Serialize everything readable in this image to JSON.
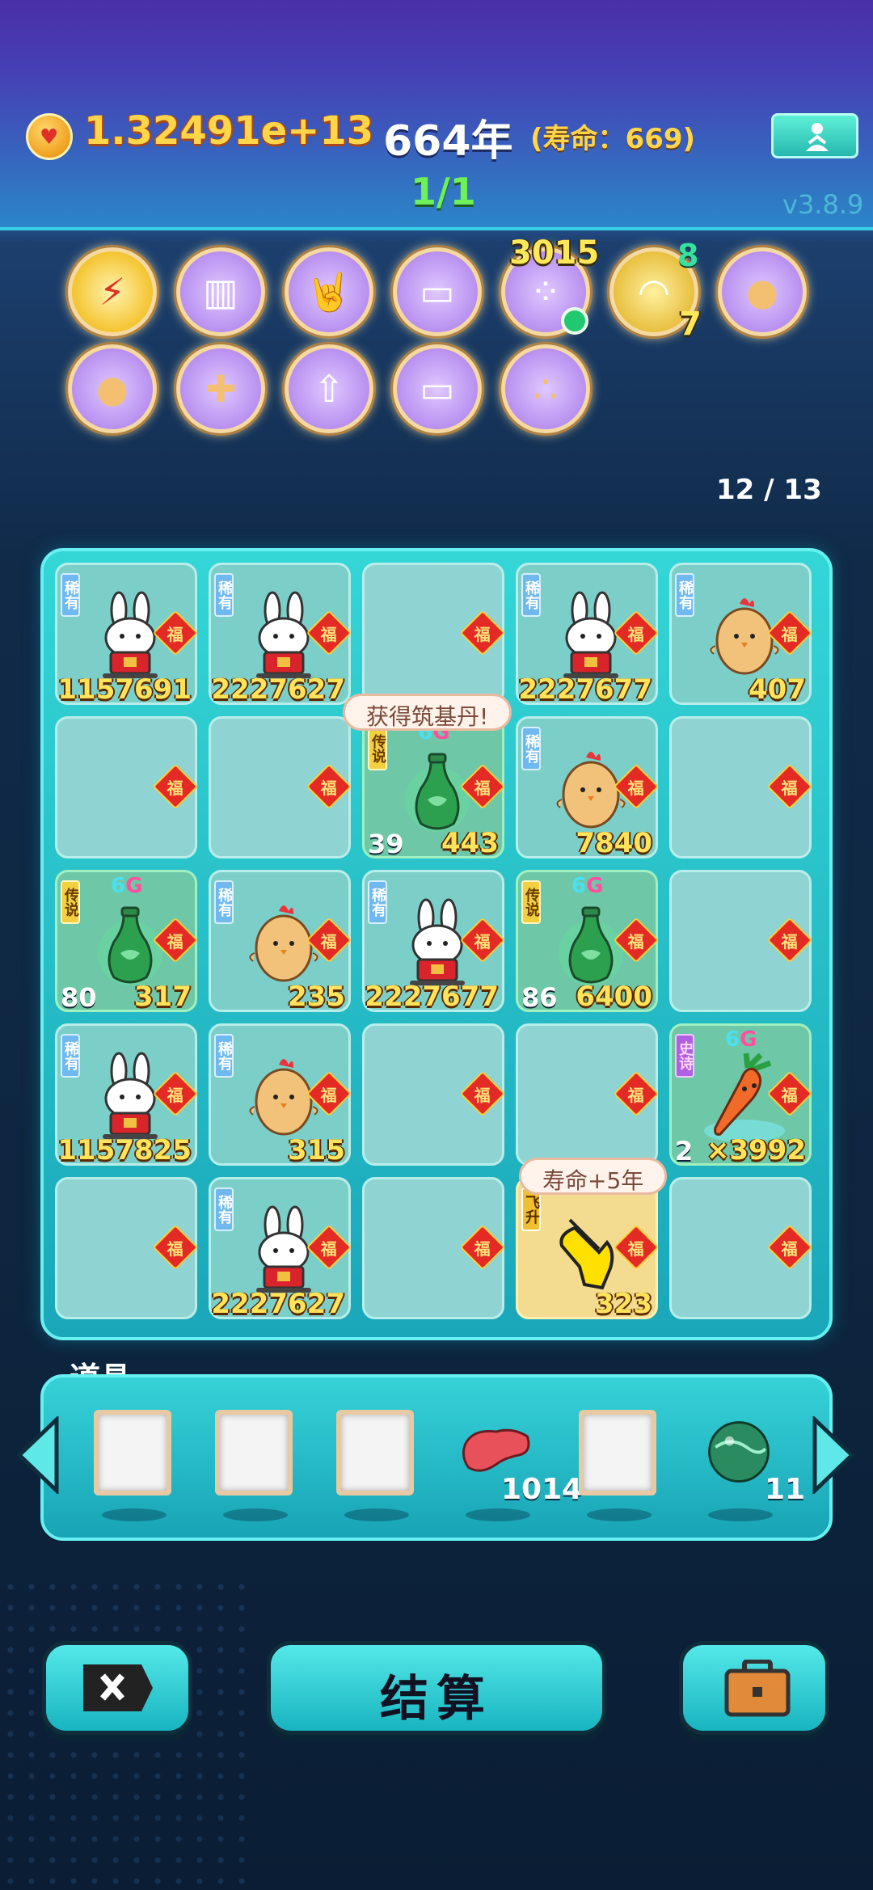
{
  "header": {
    "money": "1.32491e+13",
    "year": "664年",
    "lifespan": "(寿命：669)",
    "wave": "1/1",
    "version": "v3.8.9",
    "coin_icon": "heart-coin-icon",
    "meditate_icon": "meditation-icon"
  },
  "buffs": [
    {
      "icon": "lightning-icon",
      "glyph": "⚡"
    },
    {
      "icon": "skirt-icon",
      "glyph": "▥"
    },
    {
      "icon": "rock-hand-icon",
      "glyph": "🤘"
    },
    {
      "icon": "tissue-box-icon",
      "glyph": "▭"
    },
    {
      "icon": "egg-tray-icon",
      "glyph": "⁘",
      "count": "3015"
    },
    {
      "icon": "shell-icon",
      "glyph": "◠",
      "count_top": "8",
      "count_bottom": "7"
    },
    {
      "icon": "chick-egg-icon",
      "glyph": "●"
    },
    {
      "icon": "chick-egg-icon",
      "glyph": "●"
    },
    {
      "icon": "syringe-chick-icon",
      "glyph": "✚"
    },
    {
      "icon": "bowls-arrow-icon",
      "glyph": "⇧"
    },
    {
      "icon": "tissue-box-icon",
      "glyph": "▭"
    },
    {
      "icon": "chicks-group-icon",
      "glyph": "∴"
    }
  ],
  "board": {
    "counter": "12 / 13",
    "fu": "福",
    "rows": [
      [
        {
          "tag": "稀有",
          "type": "rabbit",
          "value": "1157691"
        },
        {
          "tag": "稀有",
          "type": "rabbit",
          "value": "2227627"
        },
        {
          "type": "empty"
        },
        {
          "tag": "稀有",
          "type": "rabbit",
          "value": "2227677"
        },
        {
          "tag": "稀有",
          "type": "chick",
          "value": "407"
        }
      ],
      [
        {
          "type": "empty"
        },
        {
          "type": "empty"
        },
        {
          "tag": "传说",
          "type": "vase",
          "value": "443",
          "level": "39",
          "grade": "6"
        },
        {
          "tag": "稀有",
          "type": "chick",
          "value": "7840"
        },
        {
          "type": "empty"
        }
      ],
      [
        {
          "tag": "传说",
          "type": "vase",
          "value": "317",
          "level": "80",
          "grade": "6"
        },
        {
          "tag": "稀有",
          "type": "chick",
          "value": "235"
        },
        {
          "tag": "稀有",
          "type": "rabbit",
          "value": "2227677"
        },
        {
          "tag": "传说",
          "type": "vase",
          "value": "6400",
          "level": "86",
          "grade": "6"
        },
        {
          "type": "empty"
        }
      ],
      [
        {
          "tag": "稀有",
          "type": "rabbit",
          "value": "1157825"
        },
        {
          "tag": "稀有",
          "type": "chick",
          "value": "315"
        },
        {
          "type": "empty"
        },
        {
          "type": "empty"
        },
        {
          "tag": "史诗",
          "type": "carrot",
          "value": "×3992",
          "level": "2",
          "grade": "6"
        }
      ],
      [
        {
          "type": "empty"
        },
        {
          "tag": "稀有",
          "type": "rabbit",
          "value": "2227627"
        },
        {
          "type": "empty"
        },
        {
          "tag": "飞升",
          "type": "hand",
          "value": "323"
        },
        {
          "type": "empty"
        }
      ]
    ],
    "bubble_top": "获得筑基丹!",
    "bubble_bottom": "寿命+5年",
    "grade_letter": "G"
  },
  "items": {
    "label": "道具",
    "slots": [
      {
        "icon": "empty-frame-icon"
      },
      {
        "icon": "empty-frame-icon"
      },
      {
        "icon": "empty-frame-icon"
      },
      {
        "icon": "liver-icon",
        "count": "1014"
      },
      {
        "icon": "empty-frame-icon"
      },
      {
        "icon": "jade-orb-icon",
        "count": "11"
      }
    ]
  },
  "buttons": {
    "close_icon": "close-x-icon",
    "settle": "结算",
    "bag_icon": "briefcase-icon"
  }
}
